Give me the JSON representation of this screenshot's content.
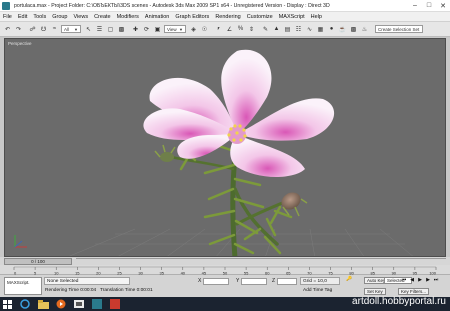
{
  "window": {
    "file_name": "portulaca.max",
    "title": "- Project Folder: C:\\ОБЪЕКТЫ\\3DS scenes    - Autodesk 3ds Max  2009 SP1  x64  - Unregistered Version    - Display : Direct 3D"
  },
  "menu": [
    "File",
    "Edit",
    "Tools",
    "Group",
    "Views",
    "Create",
    "Modifiers",
    "Animation",
    "Graph Editors",
    "Rendering",
    "Customize",
    "MAXScript",
    "Help"
  ],
  "toolbar": {
    "selection_filter": "All",
    "reference_coord": "View",
    "named_selection": "Create Selection Set"
  },
  "viewport": {
    "label": "Perspective"
  },
  "timeline": {
    "frame": "0 / 100",
    "ticks": [
      "0",
      "5",
      "10",
      "15",
      "20",
      "25",
      "30",
      "35",
      "40",
      "45",
      "50",
      "55",
      "60",
      "65",
      "70",
      "75",
      "80",
      "85",
      "90",
      "95",
      "100"
    ]
  },
  "status": {
    "maxscript": "MAXScript.",
    "selection": "None Selected",
    "rendering_time": "Rendering Time  0:00:04",
    "translation_time": "Translation Time  0:00:01",
    "x_label": "X",
    "y_label": "Y",
    "z_label": "Z",
    "grid": "Grid = 10,0",
    "add_time_tag": "Add Time Tag",
    "auto_key": "Auto Key",
    "selected": "Selected",
    "set_key": "Set Key",
    "key_filters": "Key Filters..."
  },
  "watermark": "artdoll.hobbyportal.ru",
  "colors": {
    "viewport_bg": "#6b6b6b",
    "petal": "#f3c6e8",
    "stem": "#4d6b2e",
    "taskbar": "#1b2330"
  }
}
